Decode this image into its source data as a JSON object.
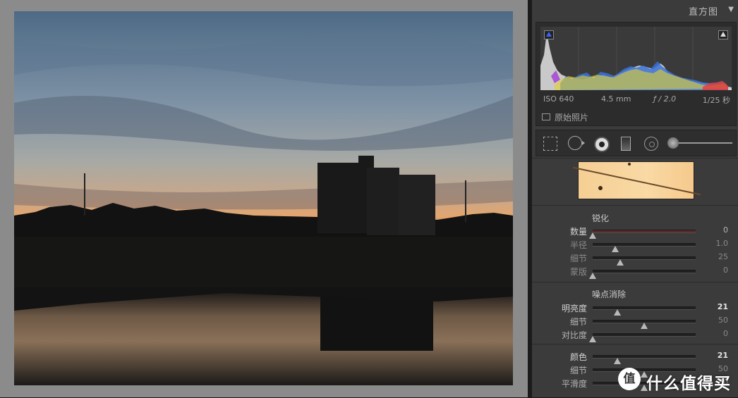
{
  "histogram": {
    "title": "直方图",
    "toggle_icon": "triangle-down-icon",
    "iso": "ISO 640",
    "focal_length": "4.5 mm",
    "aperture": "ƒ / 2.0",
    "shutter": "1/25 秒",
    "original_photo_label": "原始照片"
  },
  "tools": [
    "crop-icon",
    "spot-removal-icon",
    "red-eye-icon",
    "graduated-filter-icon",
    "radial-filter-icon",
    "adjustment-brush-icon"
  ],
  "sharpening": {
    "title": "锐化",
    "rows": [
      {
        "label": "数量",
        "value": "0",
        "pos": 0.0
      },
      {
        "label": "半径",
        "value": "1.0",
        "pos": 0.22
      },
      {
        "label": "细节",
        "value": "25",
        "pos": 0.27
      },
      {
        "label": "蒙版",
        "value": "0",
        "pos": 0.0
      }
    ]
  },
  "noise_reduction": {
    "title": "噪点消除",
    "rows": [
      {
        "label": "明亮度",
        "value": "21",
        "pos": 0.24
      },
      {
        "label": "细节",
        "value": "50",
        "pos": 0.5
      },
      {
        "label": "对比度",
        "value": "0",
        "pos": 0.0
      }
    ]
  },
  "color_noise": {
    "rows": [
      {
        "label": "颜色",
        "value": "21",
        "pos": 0.24
      },
      {
        "label": "细节",
        "value": "50",
        "pos": 0.5
      },
      {
        "label": "平滑度",
        "value": "50",
        "pos": 0.5
      }
    ]
  },
  "watermark": {
    "icon_text": "值",
    "text": "什么值得买"
  }
}
